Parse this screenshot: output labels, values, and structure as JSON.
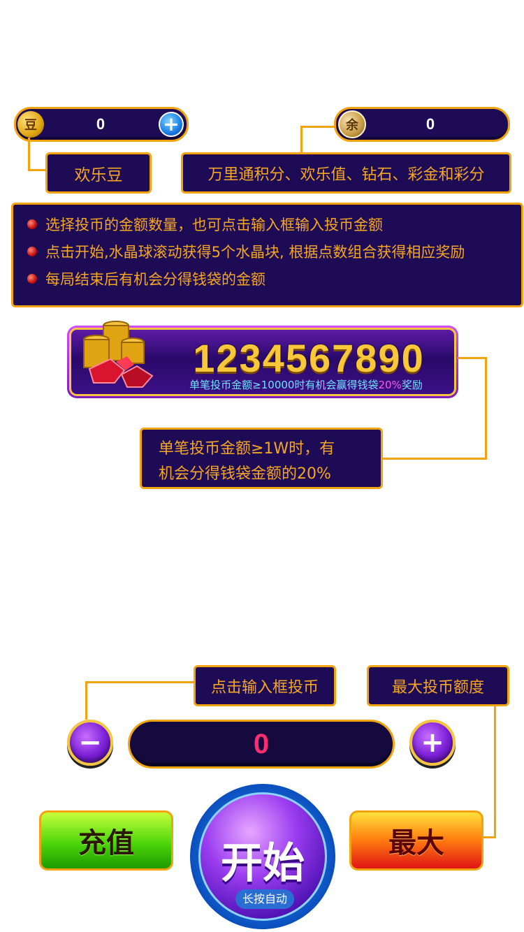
{
  "top_bar": {
    "beans": {
      "icon_char": "豆",
      "value": "0",
      "add_icon": "plus-icon"
    },
    "balance": {
      "icon_char": "余",
      "value": "0"
    }
  },
  "labels": {
    "beans_label": "欢乐豆",
    "balance_label": "万里通积分、欢乐值、钻石、彩金和彩分"
  },
  "instructions": [
    "选择投币的金额数量，也可点击输入框输入投币金额",
    "点击开始,水晶球滚动获得5个水晶块, 根据点数组合获得相应奖励",
    "每局结束后有机会分得钱袋的金额"
  ],
  "jackpot": {
    "number": "1234567890",
    "subtitle_pre": "单笔投币金额≥10000时有机会赢得钱袋",
    "subtitle_pct": "20%",
    "subtitle_post": "奖励"
  },
  "jackpot_note": {
    "line1": "单笔投币金额≥1W时，有",
    "line2": "机会分得钱袋金额的20%"
  },
  "bet": {
    "input_hint": "点击输入框投币",
    "max_hint": "最大投币额度",
    "value": "0",
    "minus": "−",
    "plus": "+"
  },
  "actions": {
    "recharge": "充值",
    "start": "开始",
    "start_sub": "长按自动",
    "max": "最大"
  },
  "colors": {
    "accent": "#f2a30f",
    "panel": "#1e0b55",
    "text_orange": "#f5a623",
    "bet_value": "#ff2d6f"
  }
}
